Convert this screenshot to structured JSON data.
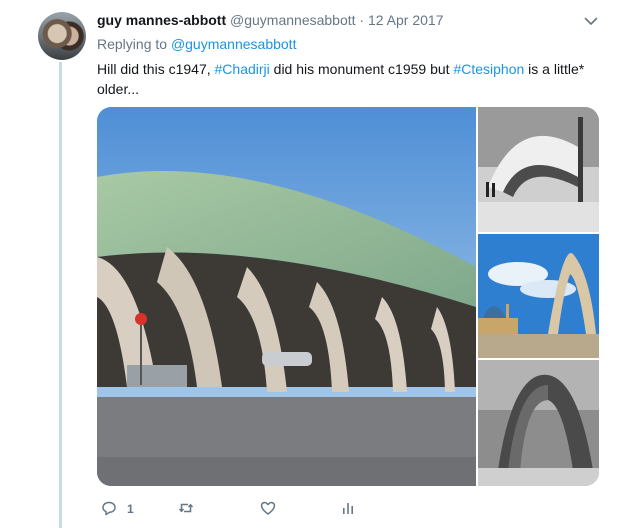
{
  "tweet": {
    "name": "guy mannes-abbott",
    "handle": "@guymannesabbott",
    "separator": "·",
    "date": "12 Apr 2017",
    "reply_prefix": "Replying to",
    "reply_mention": "@guymannesabbott",
    "text": {
      "part1": "Hill did this c1947,",
      "hashtag1": "#Chadirji",
      "part2": "did his monument c1959 but",
      "hashtag2": "#Ctesiphon",
      "part3": "is a little* older..."
    }
  },
  "actions": {
    "reply_count": "1",
    "retweet_count": "",
    "like_count": ""
  },
  "colors": {
    "link": "#1b95e0",
    "secondary": "#657786",
    "thread_line": "#c4dbe8"
  },
  "icons": {
    "reply": "speech-bubble-icon",
    "retweet": "retweet-arrows-icon",
    "like": "heart-icon",
    "analytics": "bar-chart-icon",
    "more": "chevron-down-icon"
  },
  "media": {
    "images": [
      "bus station with arched concrete canopy and green copper roof",
      "black and white arched canopy with pedestrians",
      "monumental arch beside domed mosque under blue sky",
      "black and white photo of a tall arch monument"
    ]
  }
}
